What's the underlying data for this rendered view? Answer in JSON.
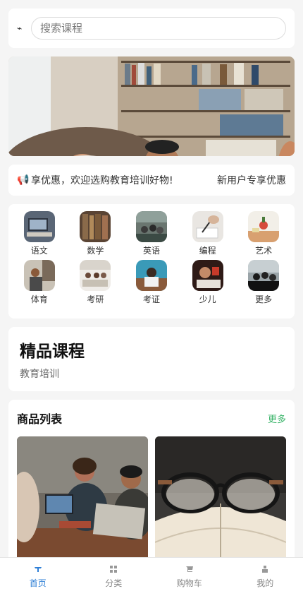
{
  "search": {
    "logo_glyph": "⌁",
    "placeholder": "搜索课程",
    "value": ""
  },
  "notice": {
    "icon": "megaphone-icon",
    "text": "享优惠，欢迎选购教育培训好物!",
    "right_text": "新用户专享优惠"
  },
  "categories": [
    {
      "label": "语文",
      "icon": "chinese-thumb"
    },
    {
      "label": "数学",
      "icon": "math-thumb"
    },
    {
      "label": "英语",
      "icon": "english-thumb"
    },
    {
      "label": "编程",
      "icon": "coding-thumb"
    },
    {
      "label": "艺术",
      "icon": "art-thumb"
    },
    {
      "label": "体育",
      "icon": "sports-thumb"
    },
    {
      "label": "考研",
      "icon": "postgrad-thumb"
    },
    {
      "label": "考证",
      "icon": "certificate-thumb"
    },
    {
      "label": "少儿",
      "icon": "kids-thumb"
    },
    {
      "label": "更多",
      "icon": "more-thumb"
    }
  ],
  "featured": {
    "title": "精品课程",
    "subtitle": "教育培训"
  },
  "products": {
    "title": "商品列表",
    "more_label": "更多"
  },
  "tabbar": {
    "active": "home",
    "items": [
      {
        "key": "home",
        "label": "首页",
        "icon": "home-icon"
      },
      {
        "key": "category",
        "label": "分类",
        "icon": "grid-icon"
      },
      {
        "key": "cart",
        "label": "购物车",
        "icon": "cart-icon"
      },
      {
        "key": "mine",
        "label": "我的",
        "icon": "user-icon"
      }
    ]
  },
  "colors": {
    "accent": "#2f7fd6",
    "more_link": "#3cb56b",
    "background": "#f5f5f5"
  }
}
